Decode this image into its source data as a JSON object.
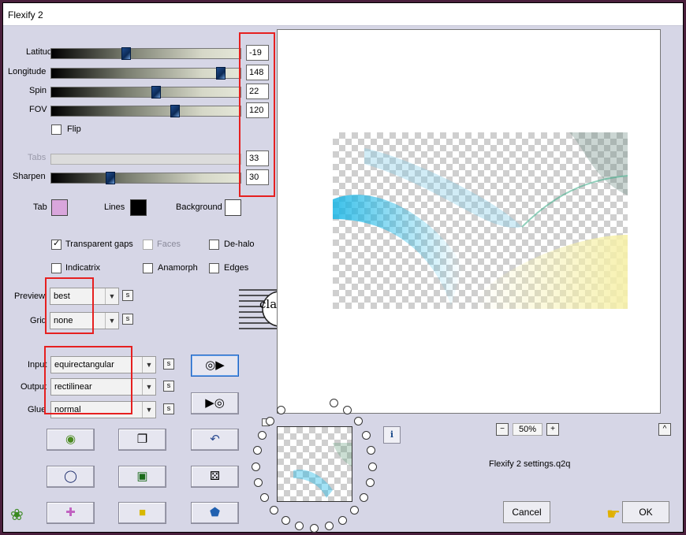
{
  "window": {
    "title": "Flexify 2"
  },
  "sliders": [
    {
      "label": "Latitude",
      "value": "-19",
      "fraction": 0.39,
      "disabled": false
    },
    {
      "label": "Longitude",
      "value": "148",
      "fraction": 0.89,
      "disabled": false
    },
    {
      "label": "Spin",
      "value": "22",
      "fraction": 0.55,
      "disabled": false
    },
    {
      "label": "FOV",
      "value": "120",
      "fraction": 0.65,
      "disabled": false
    },
    {
      "label": "Tabs",
      "value": "33",
      "fraction": null,
      "disabled": true
    },
    {
      "label": "Sharpen",
      "value": "30",
      "fraction": 0.31,
      "disabled": false
    }
  ],
  "flip": {
    "label": "Flip",
    "checked": false
  },
  "colors": {
    "tab": {
      "label": "Tab",
      "color": "#d9a6dc"
    },
    "lines": {
      "label": "Lines",
      "color": "#000000"
    },
    "background": {
      "label": "Background",
      "color": "#ffffff"
    }
  },
  "options": {
    "transparent_gaps": {
      "label": "Transparent gaps",
      "checked": true
    },
    "faces": {
      "label": "Faces",
      "checked": false,
      "disabled": true
    },
    "dehalo": {
      "label": "De-halo",
      "checked": false
    },
    "indicatrix": {
      "label": "Indicatrix",
      "checked": false
    },
    "anamorph": {
      "label": "Anamorph",
      "checked": false
    },
    "edges": {
      "label": "Edges",
      "checked": false
    }
  },
  "selects": {
    "preview": {
      "label": "Preview",
      "value": "best"
    },
    "grid": {
      "label": "Grid",
      "value": "none"
    },
    "input": {
      "label": "Input",
      "value": "equirectangular"
    },
    "output": {
      "label": "Output",
      "value": "rectilinear"
    },
    "glue": {
      "label": "Glue",
      "value": "normal"
    }
  },
  "s_label": "s",
  "zoom": {
    "minus": "−",
    "value": "50%",
    "plus": "+"
  },
  "settings_file": "Flexify 2 settings.q2q",
  "buttons": {
    "cancel": "Cancel",
    "ok": "OK",
    "info": "i",
    "collapse": "^"
  },
  "watermark": "claudia",
  "accent_color": "#e62020"
}
